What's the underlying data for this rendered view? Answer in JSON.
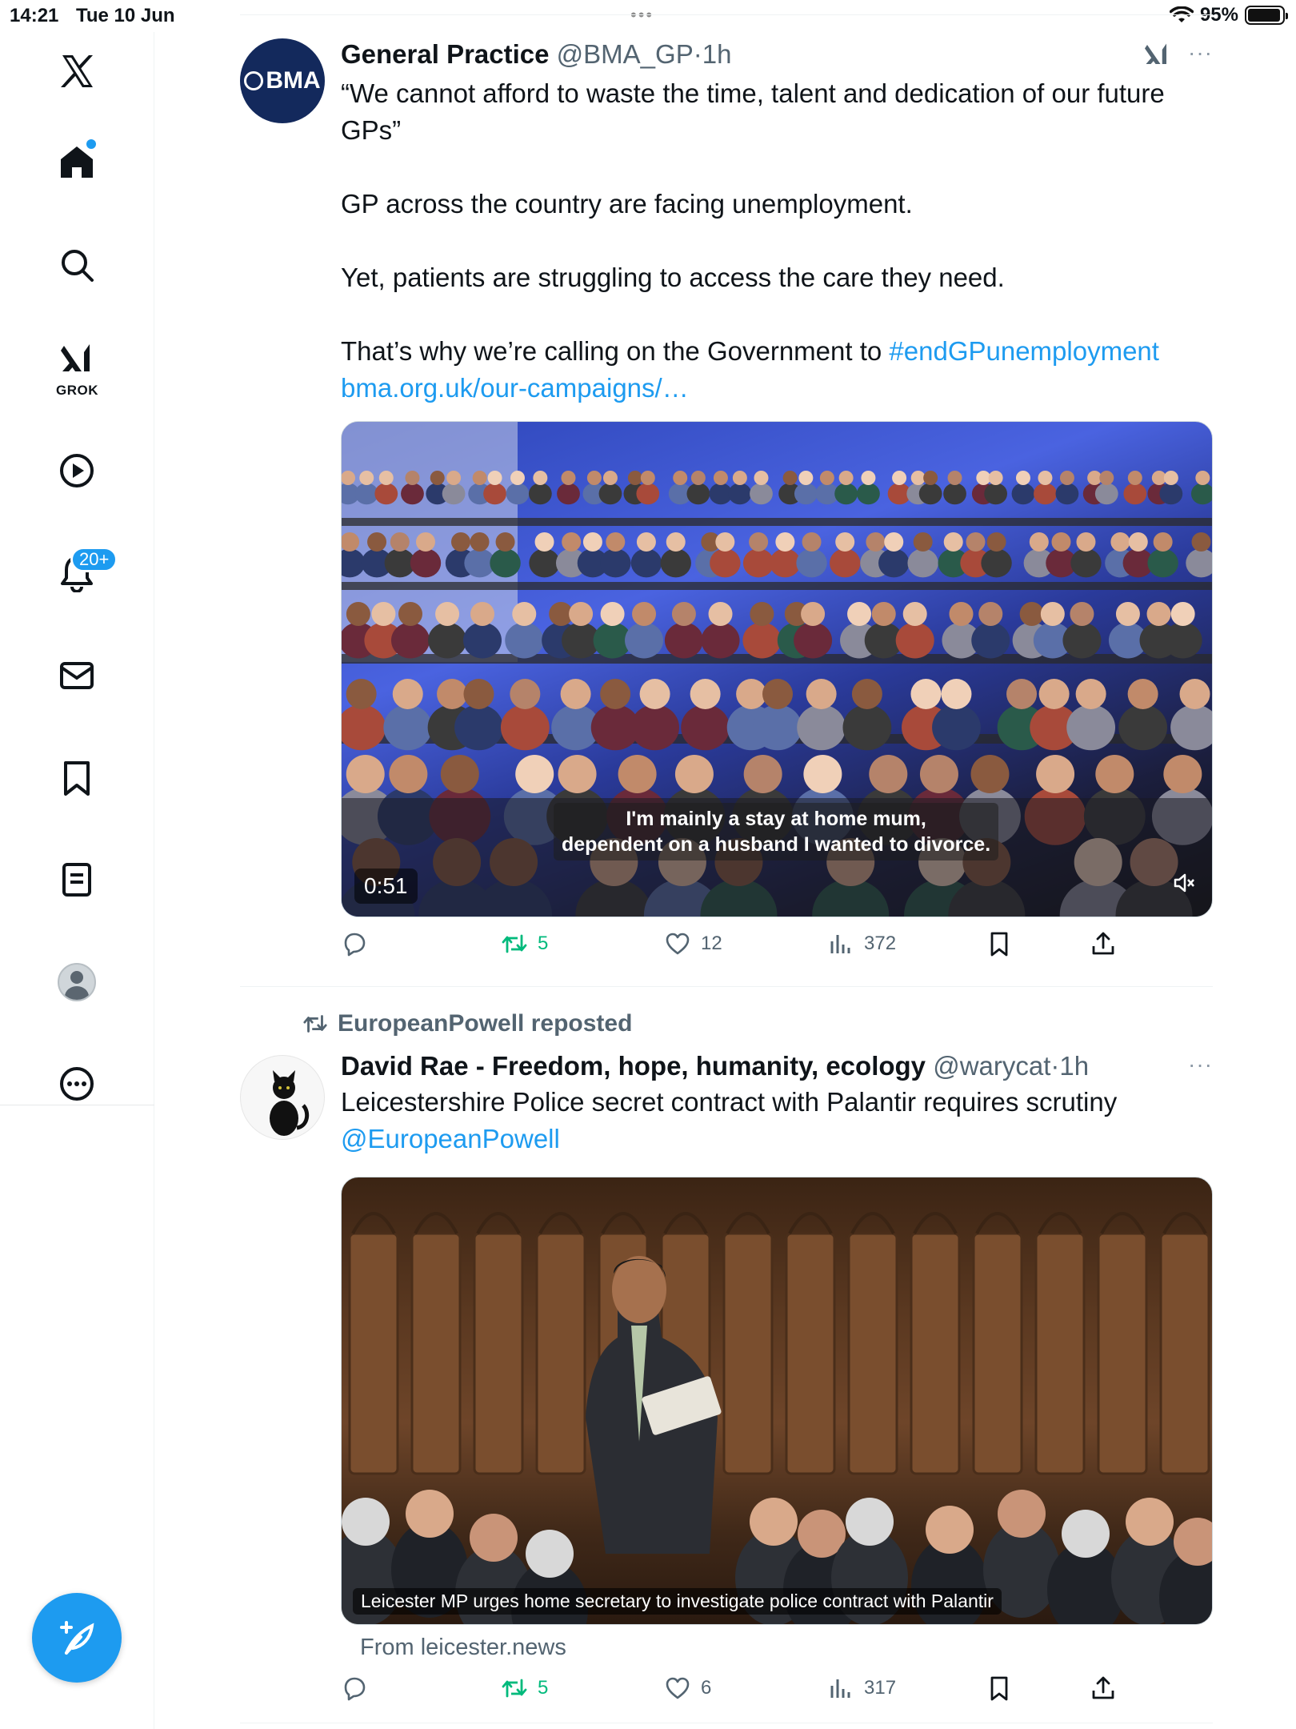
{
  "status_bar": {
    "time": "14:21",
    "date": "Tue 10 Jun",
    "dots": "•••",
    "battery": "95%",
    "battery_level": 0.95
  },
  "sidebar": {
    "items": [
      {
        "name": "x-logo-icon"
      },
      {
        "name": "home-icon"
      },
      {
        "name": "search-icon"
      },
      {
        "name": "grok-icon",
        "label": "GROK"
      },
      {
        "name": "video-icon"
      },
      {
        "name": "notifications-icon",
        "badge": "20+"
      },
      {
        "name": "messages-icon"
      },
      {
        "name": "bookmarks-icon"
      },
      {
        "name": "lists-icon"
      },
      {
        "name": "profile-icon"
      },
      {
        "name": "more-icon"
      }
    ]
  },
  "tweets": [
    {
      "avatar_text": "BMA",
      "name": "General Practice",
      "handle": "@BMA_GP",
      "separator": "·",
      "time": "1h",
      "more": "···",
      "text": [
        "“We cannot afford to waste the time, talent and dedication of our future GPs”",
        "",
        "GP across the country are facing unemployment.",
        "",
        "Yet, patients are struggling to access the care they need.",
        "",
        "That’s why we’re calling on the Government to "
      ],
      "hashtag": "#endGPunemployment",
      "link": "bma.org.uk/our-campaigns/…",
      "media": {
        "caption_line1": "I'm mainly a stay at home mum,",
        "caption_line2": "dependent on a husband I wanted to divorce.",
        "duration": "0:51"
      },
      "actions": {
        "reply": "",
        "retweets": "5",
        "likes": "12",
        "views": "372"
      }
    },
    {
      "reposted_by": "EuropeanPowell reposted",
      "name": "David Rae - Freedom, hope, humanity, ecology",
      "handle": "@warycat",
      "separator": "·",
      "time": "1h",
      "more": "···",
      "text": "Leicestershire Police secret contract with Palantir requires scrutiny",
      "mention": "@EuropeanPowell",
      "media": {
        "card_caption": "Leicester MP urges home secretary to investigate police contract with Palantir",
        "from": "From leicester.news"
      },
      "actions": {
        "reply": "",
        "retweets": "5",
        "likes": "6",
        "views": "317"
      }
    }
  ],
  "colors": {
    "accent": "#1d9bf0",
    "retweet": "#00ba7c",
    "secondary_text": "#536471"
  }
}
